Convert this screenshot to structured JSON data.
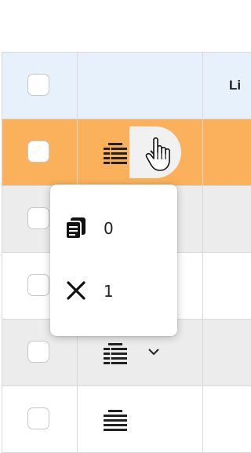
{
  "table": {
    "header": {
      "third_column_label": "Li"
    },
    "rows": [
      {
        "state": "selected"
      },
      {
        "state": "gray"
      },
      {
        "state": "white"
      },
      {
        "state": "gray"
      },
      {
        "state": "white"
      }
    ]
  },
  "dropdown_menu": {
    "items": [
      {
        "icon": "copy-documents-icon",
        "label": "0"
      },
      {
        "icon": "close-icon",
        "label": "1"
      }
    ]
  },
  "colors": {
    "header_bg": "#e6f1fb",
    "selected_row_bg": "#fbb15b",
    "alt_row_bg": "#ececec",
    "border": "#d9d9d9"
  }
}
